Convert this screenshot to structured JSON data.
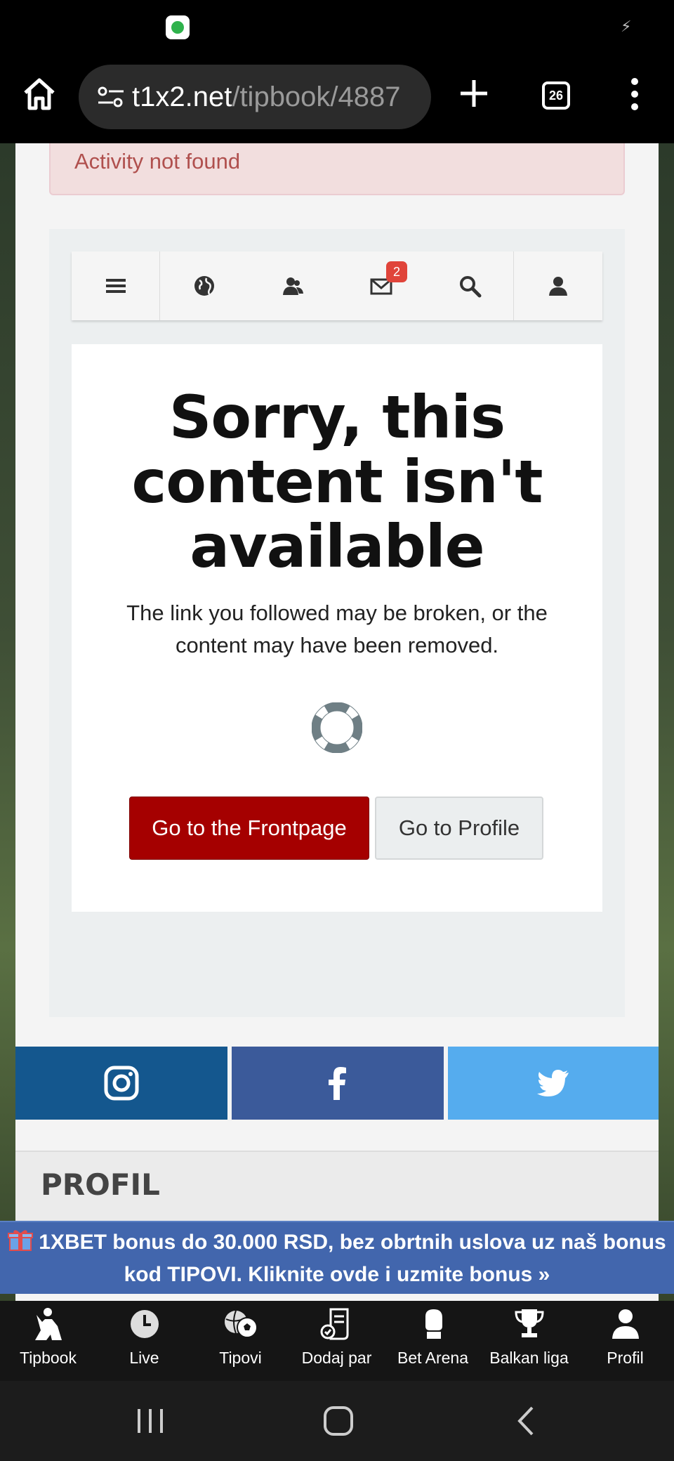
{
  "browser": {
    "url_domain": "t1x2.net",
    "url_path": "/tipbook/4887",
    "tab_count": "26"
  },
  "alert": {
    "text": "Activity not found"
  },
  "toolbar": {
    "items": [
      "menu-icon",
      "globe-icon",
      "friends-icon",
      "mail-icon",
      "search-icon",
      "user-icon"
    ],
    "mail_badge": "2"
  },
  "error": {
    "title": "Sorry, this content isn't available",
    "message": "The link you followed may be broken, or the content may have been removed.",
    "frontpage_label": "Go to the Frontpage",
    "profile_label": "Go to Profile"
  },
  "social": [
    "instagram",
    "facebook",
    "twitter"
  ],
  "profil": {
    "heading": "PROFIL"
  },
  "promo": {
    "text": "1XBET bonus do 30.000 RSD, bez obrtnih uslova uz naš bonus kod TIPOVI. Kliknite ovde i uzmite bonus »"
  },
  "tabs": [
    {
      "label": "Tipbook",
      "icon": "player-icon"
    },
    {
      "label": "Live",
      "icon": "clock-icon"
    },
    {
      "label": "Tipovi",
      "icon": "balls-icon"
    },
    {
      "label": "Dodaj par",
      "icon": "ticket-icon"
    },
    {
      "label": "Bet Arena",
      "icon": "glove-icon"
    },
    {
      "label": "Balkan liga",
      "icon": "trophy-icon"
    },
    {
      "label": "Profil",
      "icon": "profile-icon"
    }
  ],
  "colors": {
    "primary_button": "#a50000",
    "alert_text": "#b0504e",
    "promo_bg": "#4266ad",
    "instagram": "#14578e",
    "facebook": "#3b5a9a",
    "twitter": "#55acee",
    "badge": "#e0443a"
  }
}
